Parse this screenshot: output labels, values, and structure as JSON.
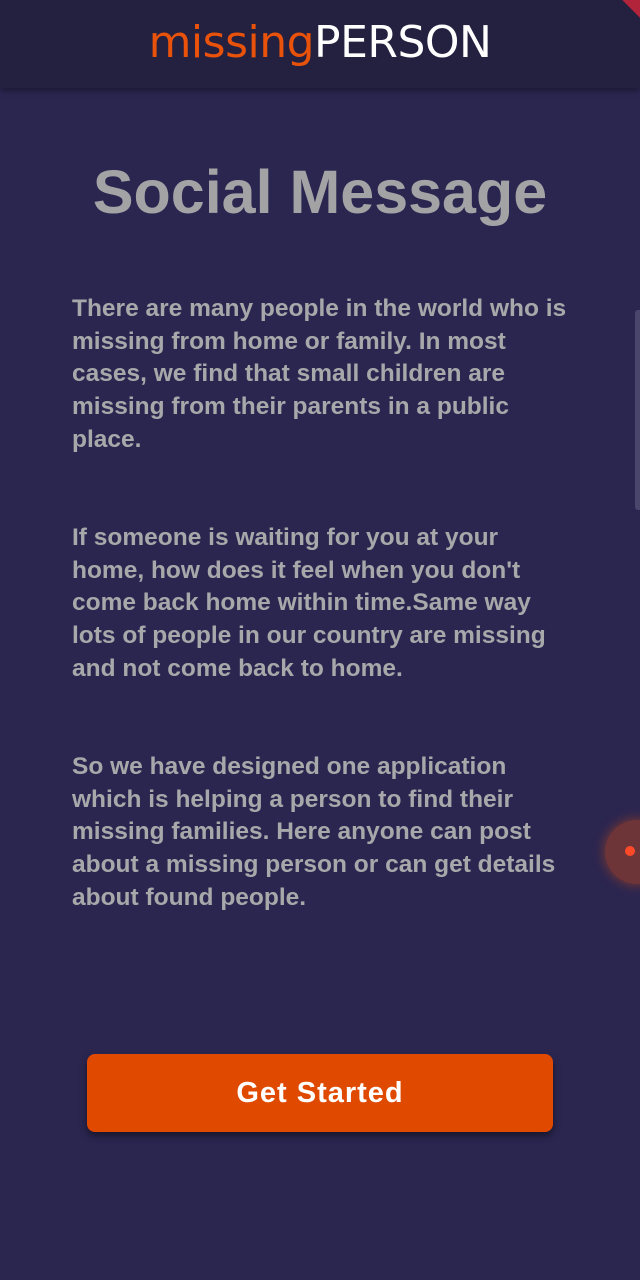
{
  "header": {
    "logo_part1": "missing",
    "logo_part2": "PERSON"
  },
  "main": {
    "title": "Social Message",
    "paragraphs": [
      "There are many people in the world who is missing from home or family. In most cases, we find that small children are missing from their parents in a public place.",
      "If someone is waiting for you at your home, how does it feel when you don't come back home within time.Same way lots of people in our country are missing and not come back to home.",
      "So we have designed one application which is helping a person to find their missing families. Here anyone can post about a missing person or can get details about found people."
    ],
    "cta_label": "Get Started"
  },
  "colors": {
    "background": "#2b2650",
    "app_bar": "#24203f",
    "accent": "#e04a00",
    "logo_orange": "#e8520a",
    "text_gray": "#a8a8ab"
  }
}
